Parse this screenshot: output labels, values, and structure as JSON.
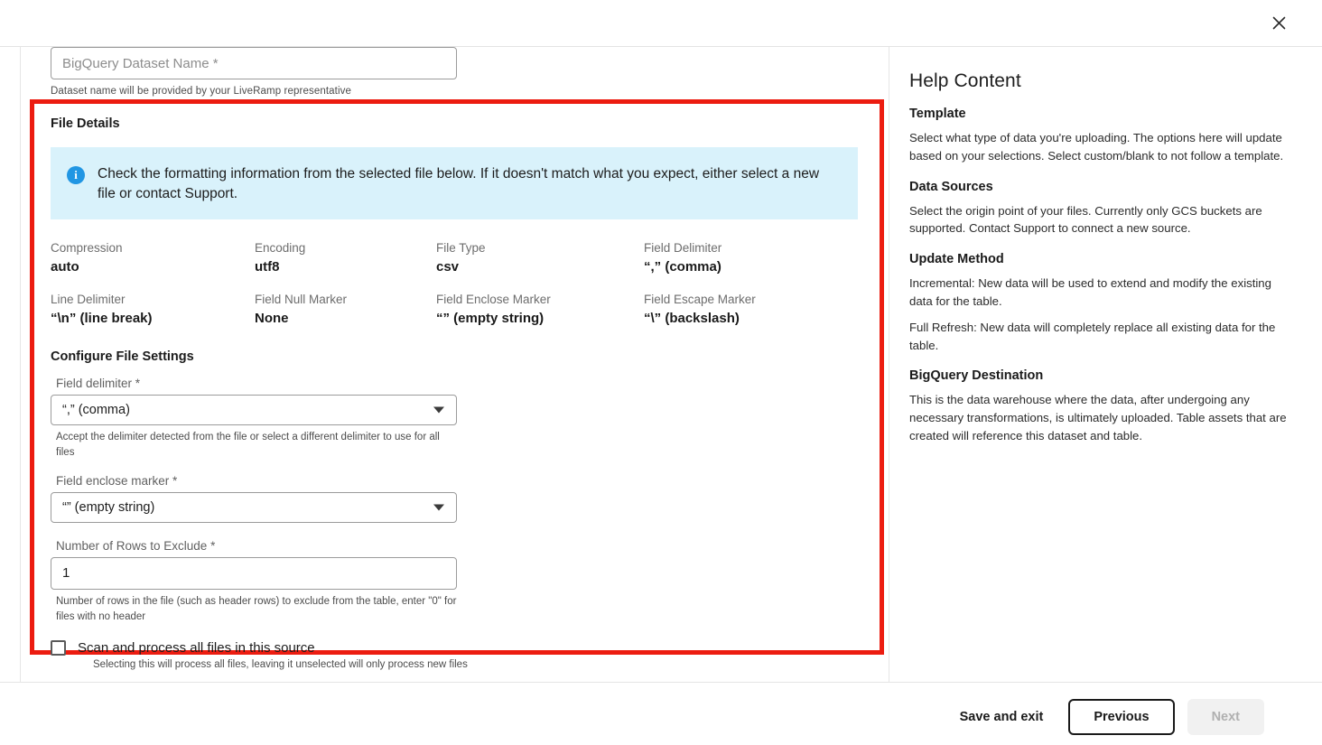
{
  "window": {
    "close_icon": "close-icon"
  },
  "dataset": {
    "placeholder": "BigQuery Dataset Name *",
    "value": "",
    "helper": "Dataset name will be provided by your LiveRamp representative"
  },
  "file_details": {
    "title": "File Details",
    "banner": {
      "icon": "info-icon",
      "text": "Check the formatting information from the selected file below. If it doesn't match what you expect, either select a new file or contact Support."
    },
    "properties": [
      {
        "label": "Compression",
        "value": "auto"
      },
      {
        "label": "Encoding",
        "value": "utf8"
      },
      {
        "label": "File Type",
        "value": "csv"
      },
      {
        "label": "Field Delimiter",
        "value": "“,” (comma)"
      },
      {
        "label": "Line Delimiter",
        "value": "“\\n” (line break)"
      },
      {
        "label": "Field Null Marker",
        "value": "None"
      },
      {
        "label": "Field Enclose Marker",
        "value": "“” (empty string)"
      },
      {
        "label": "Field Escape Marker",
        "value": "“\\” (backslash)"
      }
    ],
    "configure": {
      "title": "Configure File Settings",
      "field_delimiter": {
        "label": "Field delimiter *",
        "value": "“,” (comma)",
        "helper": "Accept the delimiter detected from the file or select a different delimiter to use for all files"
      },
      "field_enclose_marker": {
        "label": "Field enclose marker *",
        "value": "“” (empty string)",
        "helper": ""
      },
      "rows_to_exclude": {
        "label": "Number of Rows to Exclude *",
        "value": "1",
        "helper": "Number of rows in the file (such as header rows) to exclude from the table, enter \"0\" for files with no header"
      },
      "scan_all_files": {
        "label": "Scan and process all files in this source",
        "checked": false,
        "helper": "Selecting this will process all files, leaving it unselected will only process new files"
      }
    }
  },
  "help": {
    "title": "Help Content",
    "sections": [
      {
        "heading": "Template",
        "paragraphs": [
          "Select what type of data you're uploading. The options here will update based on your selections. Select custom/blank to not follow a template."
        ]
      },
      {
        "heading": "Data Sources",
        "paragraphs": [
          "Select the origin point of your files. Currently only GCS buckets are supported. Contact Support to connect a new source."
        ]
      },
      {
        "heading": "Update Method",
        "paragraphs": [
          "Incremental: New data will be used to extend and modify the existing data for the table.",
          "Full Refresh: New data will completely replace all existing data for the table."
        ]
      },
      {
        "heading": "BigQuery Destination",
        "paragraphs": [
          "This is the data warehouse where the data, after undergoing any necessary transformations, is ultimately uploaded. Table assets that are created will reference this dataset and table."
        ]
      }
    ]
  },
  "footer": {
    "save_and_exit": "Save and exit",
    "previous": "Previous",
    "next": "Next"
  },
  "colors": {
    "highlight_border": "#ec1c10",
    "banner_bg": "#d9f2fb",
    "info_icon": "#2196e3"
  }
}
